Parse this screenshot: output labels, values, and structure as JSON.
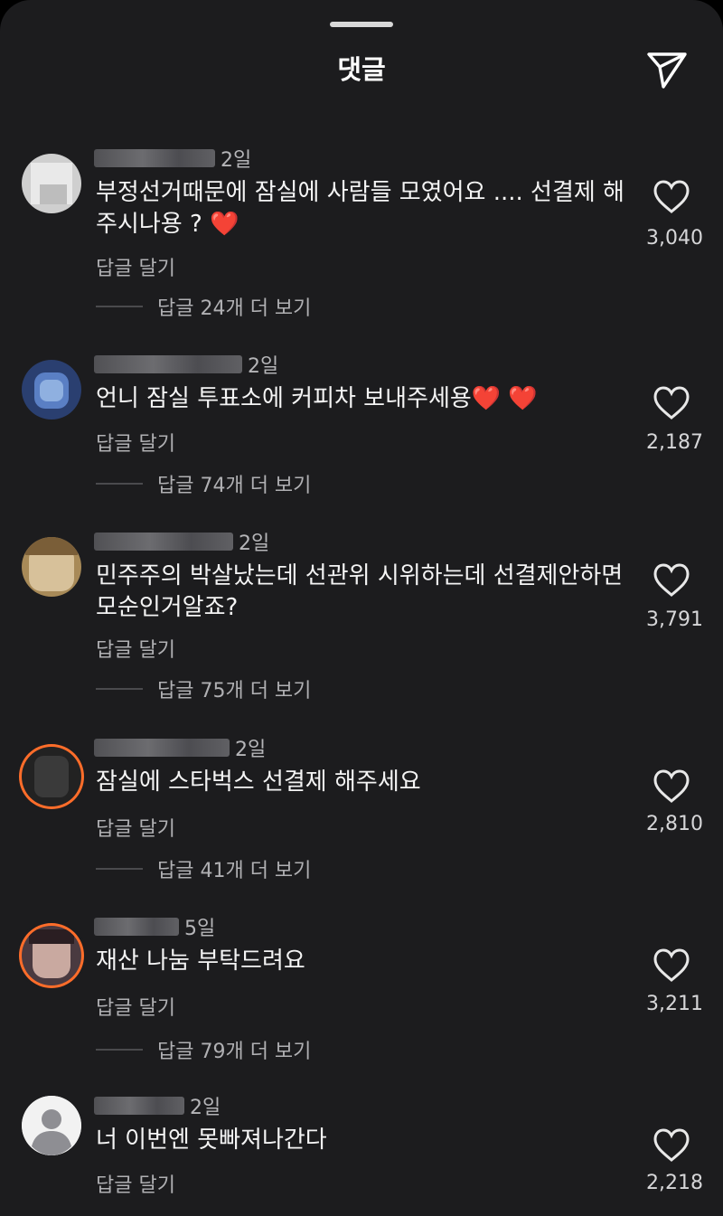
{
  "header": {
    "title": "댓글",
    "send_icon": "paper-plane-icon"
  },
  "reply_label": "답글 달기",
  "comments": [
    {
      "username": "",
      "time": "2일",
      "text": "부정선거때문에 잠실에 사람들 모였어요 .... 선결제 해주시나용 ? ❤️",
      "likes": "3,040",
      "more_replies": "답글 24개 더 보기"
    },
    {
      "username": "",
      "time": "2일",
      "text": "언니 잠실 투표소에 커피차 보내주세용❤️ ❤️",
      "likes": "2,187",
      "more_replies": "답글 74개 더 보기"
    },
    {
      "username": "",
      "time": "2일",
      "text": "민주주의 박살났는데 선관위 시위하는데 선결제안하면 모순인거알죠?",
      "likes": "3,791",
      "more_replies": "답글 75개 더 보기"
    },
    {
      "username": "",
      "time": "2일",
      "text": "잠실에 스타벅스 선결제 해주세요",
      "likes": "2,810",
      "more_replies": "답글 41개 더 보기"
    },
    {
      "username": "",
      "time": "5일",
      "text": "재산 나눔 부탁드려요",
      "likes": "3,211",
      "more_replies": "답글 79개 더 보기"
    },
    {
      "username": "",
      "time": "2일",
      "text": "너 이번엔 못빠져나간다",
      "likes": "2,218",
      "more_replies": ""
    }
  ],
  "colors": {
    "background": "#1c1c1e",
    "story_ring": "#ff6d2a"
  }
}
